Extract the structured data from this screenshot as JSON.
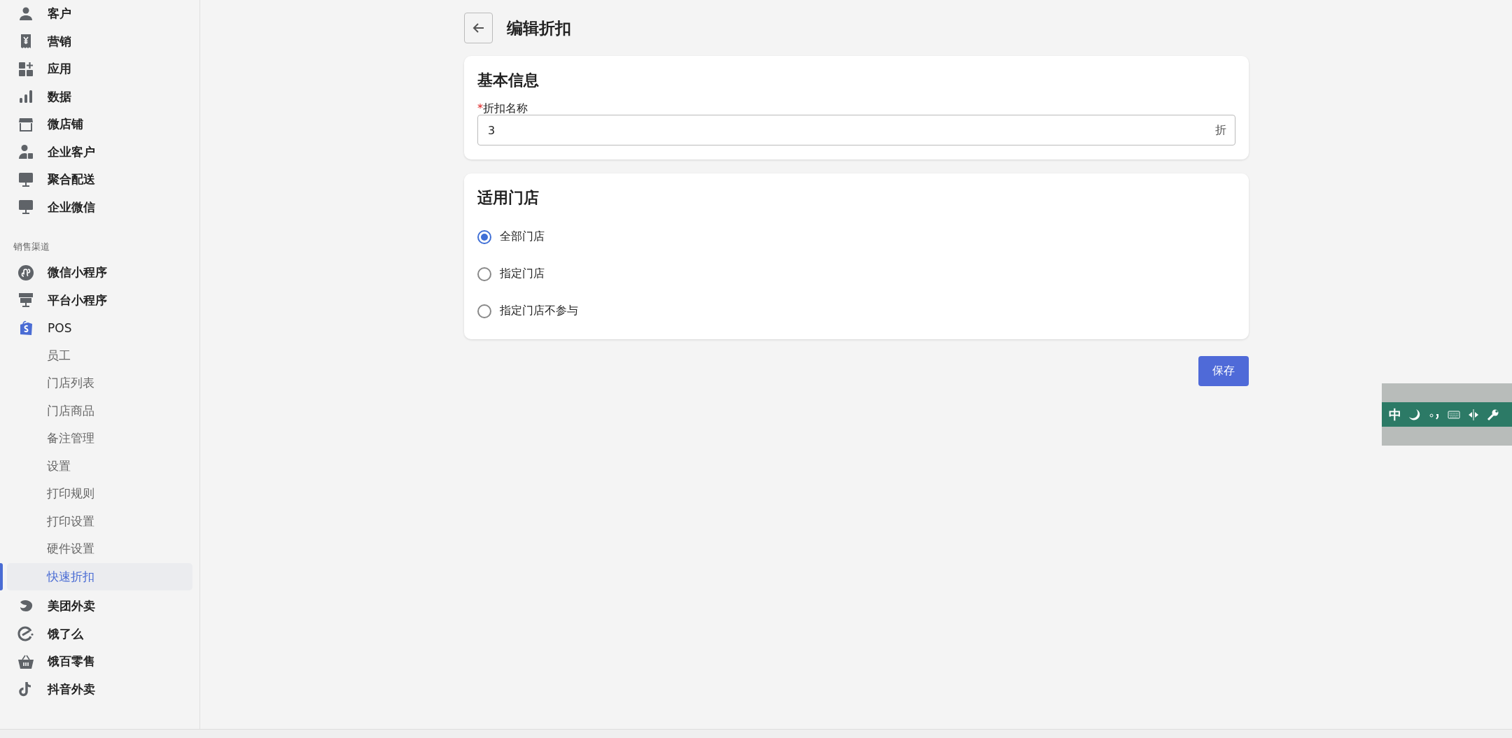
{
  "sidebar": {
    "items": [
      {
        "label": "客户"
      },
      {
        "label": "营销"
      },
      {
        "label": "应用"
      },
      {
        "label": "数据"
      },
      {
        "label": "微店铺"
      },
      {
        "label": "企业客户"
      },
      {
        "label": "聚合配送"
      },
      {
        "label": "企业微信"
      }
    ],
    "section": {
      "title": "销售渠道",
      "items": [
        {
          "label": "微信小程序",
          "expanded": false
        },
        {
          "label": "平台小程序",
          "expanded": false
        },
        {
          "label": "POS",
          "expanded": true,
          "children": [
            {
              "label": "员工",
              "selected": false
            },
            {
              "label": "门店列表",
              "selected": false
            },
            {
              "label": "门店商品",
              "selected": false
            },
            {
              "label": "备注管理",
              "selected": false
            },
            {
              "label": "设置",
              "selected": false
            },
            {
              "label": "打印规则",
              "selected": false
            },
            {
              "label": "打印设置",
              "selected": false
            },
            {
              "label": "硬件设置",
              "selected": false
            },
            {
              "label": "快速折扣",
              "selected": true
            }
          ]
        },
        {
          "label": "美团外卖",
          "expanded": false
        },
        {
          "label": "饿了么",
          "expanded": false
        },
        {
          "label": "饿百零售",
          "expanded": false
        },
        {
          "label": "抖音外卖",
          "expanded": false
        }
      ]
    }
  },
  "page": {
    "title": "编辑折扣"
  },
  "basic_info": {
    "title": "基本信息",
    "field": {
      "required_mark": "*",
      "label": "折扣名称",
      "value": "3",
      "suffix": "折"
    }
  },
  "stores": {
    "title": "适用门店",
    "options": [
      {
        "label": "全部门店",
        "selected": true
      },
      {
        "label": "指定门店",
        "selected": false
      },
      {
        "label": "指定门店不参与",
        "selected": false
      }
    ]
  },
  "save_button": "保存",
  "ime_toolbar": {
    "mode": "中"
  }
}
